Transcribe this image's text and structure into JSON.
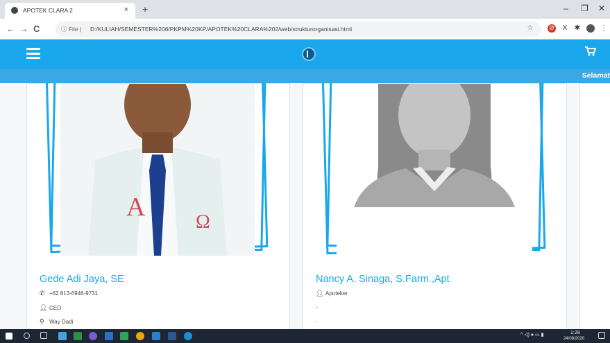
{
  "browser": {
    "tab_title": "APOTEK CLARA 2",
    "tab_close": "×",
    "new_tab": "+",
    "minimize": "–",
    "maximize": "❐",
    "close": "✕",
    "back": "←",
    "forward": "→",
    "reload": "C",
    "url_prefix": "ⓘ File |",
    "url": "D:/KULIAH/SEMESTER%206/PKPM%20KP/APOTEK%20CLARA%202/web/strukturorganisasi.html"
  },
  "header": {
    "greeting": "Selamat"
  },
  "staff": [
    {
      "name": "Gede Adi Jaya, SE",
      "phone": "+62 813-6946-9731",
      "role": "CEO",
      "location": "Way Dadi"
    },
    {
      "name": "Nancy A. Sinaga, S.Farm.,Apt",
      "role": "Apoteker",
      "line2": "-",
      "line3": "-"
    }
  ],
  "taskbar": {
    "time": "1:28",
    "date": "24/08/2020"
  },
  "colors": {
    "accent": "#1aa7ec",
    "subbar": "#3aa8e4",
    "taskbar": "#1c2733"
  },
  "icons": [
    "hamburger-icon",
    "logo-icon",
    "cart-icon",
    "phone-icon",
    "user-icon",
    "location-icon"
  ]
}
